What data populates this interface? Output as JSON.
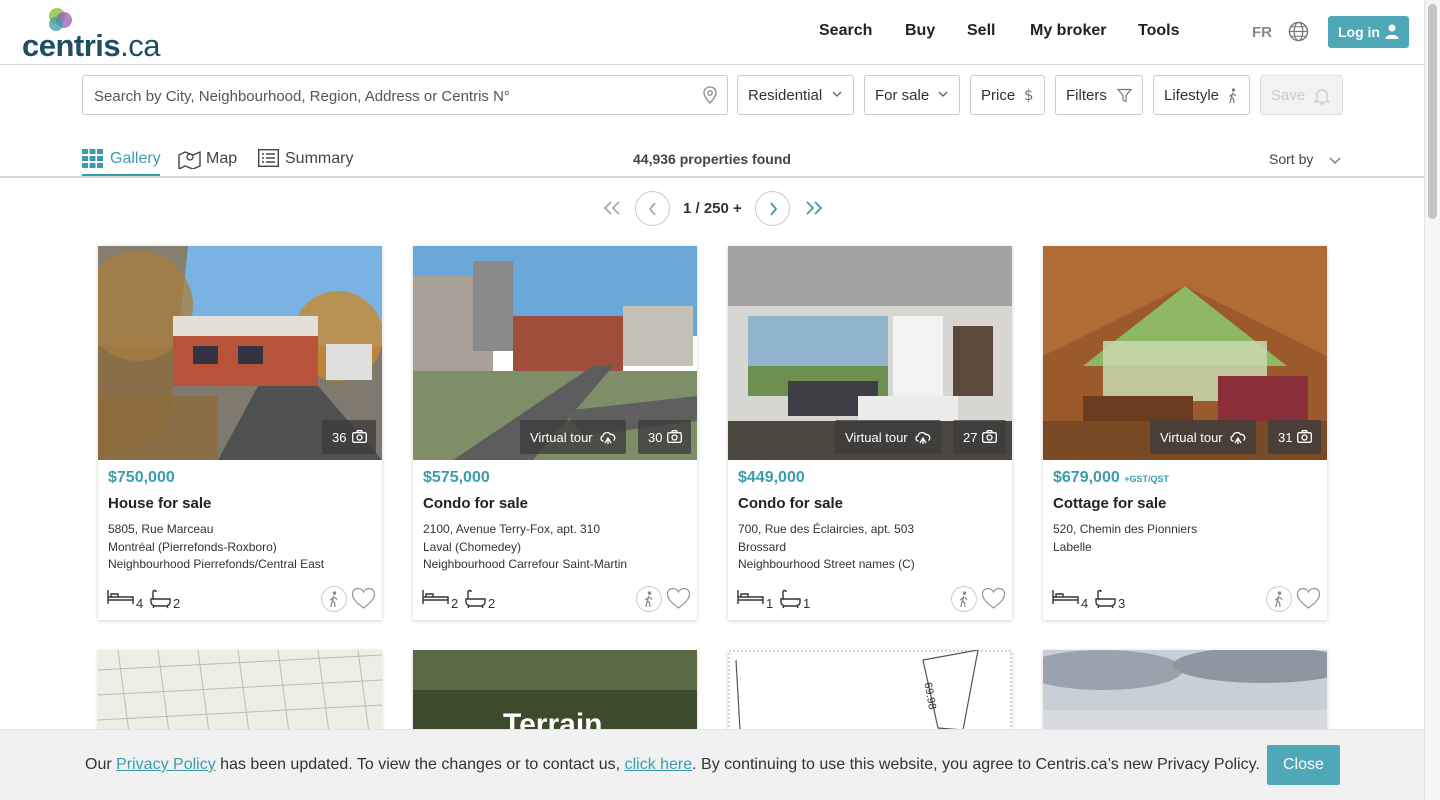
{
  "header": {
    "logo_text": "centris",
    "logo_suffix": ".ca",
    "nav": [
      "Search",
      "Buy",
      "Sell",
      "My broker",
      "Tools"
    ],
    "lang": "FR",
    "login_label": "Log in"
  },
  "search": {
    "placeholder": "Search by City, Neighbourhood, Region, Address or Centris N°",
    "category": "Residential",
    "transaction": "For sale",
    "price_label": "Price",
    "filters_label": "Filters",
    "lifestyle_label": "Lifestyle",
    "save_label": "Save"
  },
  "views": {
    "gallery": "Gallery",
    "map": "Map",
    "summary": "Summary",
    "count": "44,936 properties found",
    "sort": "Sort by"
  },
  "pagination": {
    "text": "1 / 250 +"
  },
  "listings": [
    {
      "price": "$750,000",
      "tax": "",
      "type": "House for sale",
      "address1": "5805, Rue Marceau",
      "address2": "Montréal (Pierrefonds-Roxboro)",
      "address3": "Neighbourhood Pierrefonds/Central East",
      "photos": "36",
      "virtual_tour": "",
      "beds": "4",
      "baths": "2"
    },
    {
      "price": "$575,000",
      "tax": "",
      "type": "Condo for sale",
      "address1": "2100, Avenue Terry-Fox, apt. 310",
      "address2": "Laval (Chomedey)",
      "address3": "Neighbourhood Carrefour Saint-Martin",
      "photos": "30",
      "virtual_tour": "Virtual tour",
      "beds": "2",
      "baths": "2"
    },
    {
      "price": "$449,000",
      "tax": "",
      "type": "Condo for sale",
      "address1": "700, Rue des Éclaircies, apt. 503",
      "address2": "Brossard",
      "address3": "Neighbourhood Street names (C)",
      "photos": "27",
      "virtual_tour": "Virtual tour",
      "beds": "1",
      "baths": "1"
    },
    {
      "price": "$679,000",
      "tax": "+GST/QST",
      "type": "Cottage for sale",
      "address1": "520, Chemin des Pionniers",
      "address2": "Labelle",
      "address3": "",
      "photos": "31",
      "virtual_tour": "Virtual tour",
      "beds": "4",
      "baths": "3"
    }
  ],
  "second_row": {
    "terrain_label": "Terrain",
    "plan_label_1": "69.98"
  },
  "cookie": {
    "text_before": "Our ",
    "link1": "Privacy Policy",
    "text_mid": " has been updated. To view the changes or to contact us, ",
    "link2": "click here",
    "text_after": ". By continuing to use this website, you agree to Centris.ca’s new Privacy Policy.",
    "close_label": "Close"
  },
  "colors": {
    "accent": "#4ea8b7",
    "price": "#3a9dac",
    "logo": "#1e4e63"
  },
  "icons": [
    "globe-icon",
    "user-icon",
    "location-pin-icon",
    "chevron-down-icon",
    "dollar-icon",
    "funnel-icon",
    "walker-icon",
    "bell-icon",
    "gallery-grid-icon",
    "map-icon",
    "list-icon",
    "camera-icon",
    "cloud-tour-icon",
    "bed-icon",
    "bath-icon",
    "heart-icon"
  ]
}
